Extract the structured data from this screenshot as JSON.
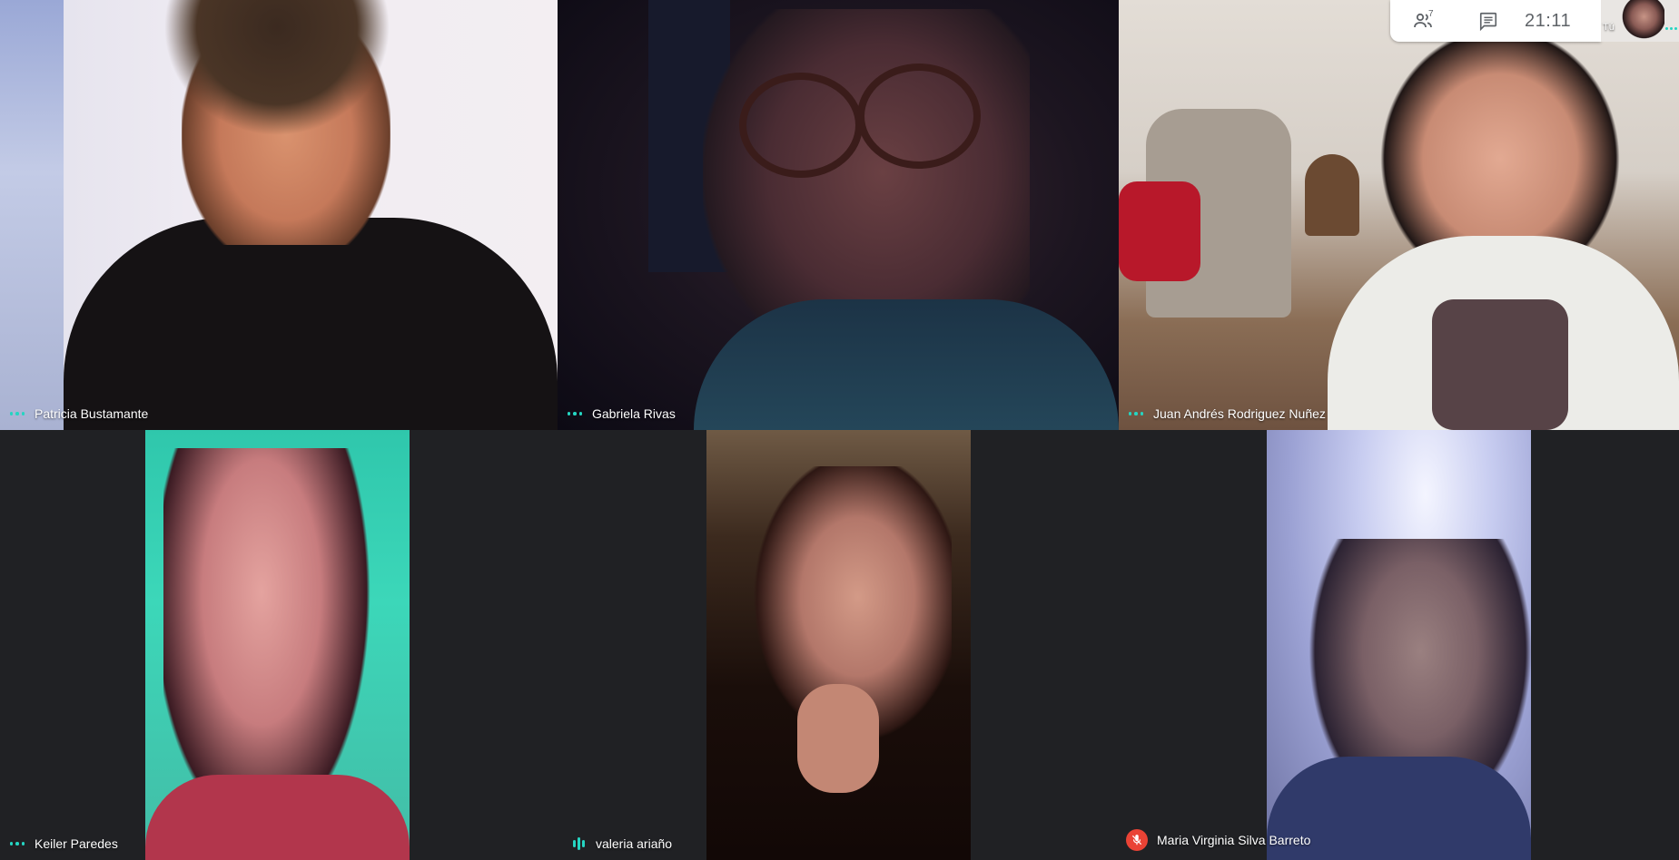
{
  "app": {
    "clock": "21:11",
    "participants_count": "7",
    "self_label": "Tú"
  },
  "colors": {
    "background": "#202124",
    "accent": "#25d5c2",
    "mute_red": "#ea4335"
  },
  "icons": {
    "participants": "people-icon",
    "chat": "chat-icon",
    "more": "three-dots-icon",
    "speaking": "audio-level-icon",
    "muted": "mic-off-icon"
  },
  "tiles": [
    {
      "name": "Patricia Bustamante",
      "status": "idle"
    },
    {
      "name": "Gabriela Rivas",
      "status": "idle"
    },
    {
      "name": "Juan Andrés Rodriguez Nuñez",
      "status": "idle"
    },
    {
      "name": "Keiler Paredes",
      "status": "idle"
    },
    {
      "name": "valeria ariaño",
      "status": "speaking"
    },
    {
      "name": "Maria Virginia Silva Barreto",
      "status": "muted"
    }
  ]
}
